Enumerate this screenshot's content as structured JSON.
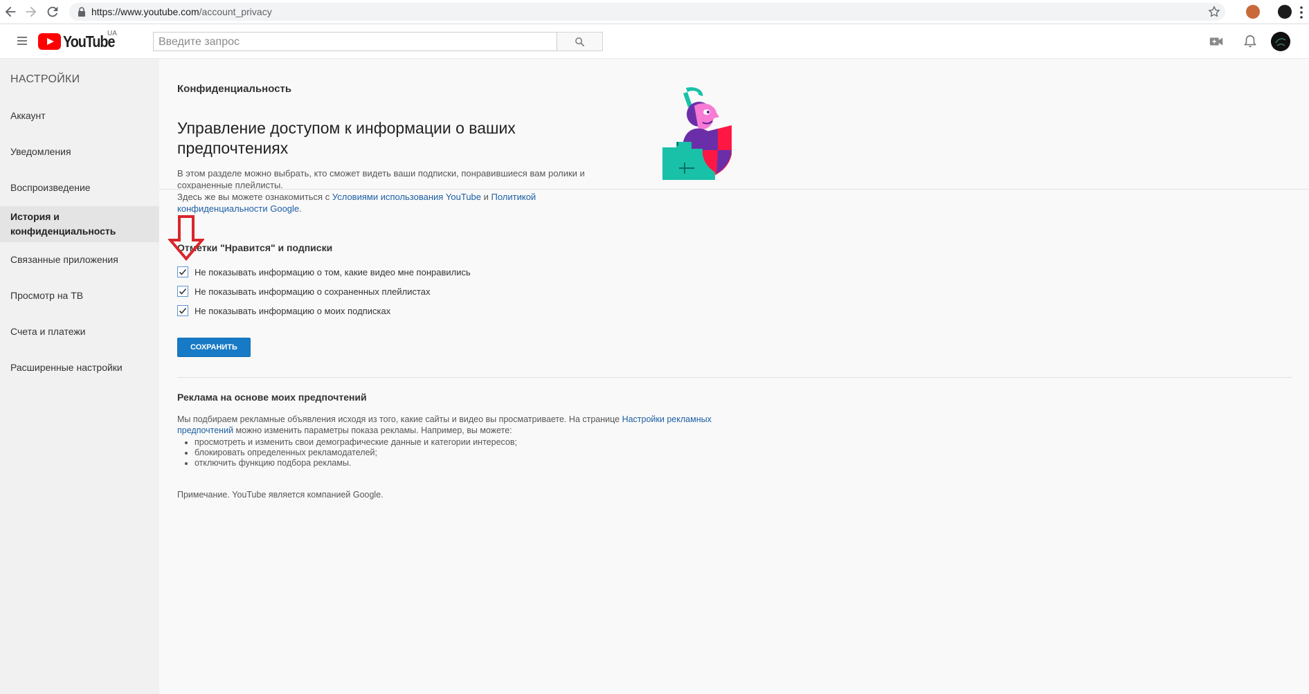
{
  "browser": {
    "url_host": "https://www.youtube.com",
    "url_path": "/account_privacy"
  },
  "header": {
    "logo_text": "YouTube",
    "logo_country": "UA",
    "search_placeholder": "Введите запрос"
  },
  "sidebar": {
    "title": "НАСТРОЙКИ",
    "items": [
      {
        "label": "Аккаунт"
      },
      {
        "label": "Уведомления"
      },
      {
        "label": "Воспроизведение"
      },
      {
        "label": "История и конфиденциальность",
        "active": true
      },
      {
        "label": "Связанные приложения"
      },
      {
        "label": "Просмотр на ТВ"
      },
      {
        "label": "Счета и платежи"
      },
      {
        "label": "Расширенные настройки"
      }
    ]
  },
  "main": {
    "page_title": "Конфиденциальность",
    "headline": "Управление доступом к информации о ваших предпочтениях",
    "desc_line1": "В этом разделе можно выбрать, кто сможет видеть ваши подписки, понравившиеся вам ролики и сохраненные плейлисты.",
    "desc_line2_prefix": "Здесь же вы можете ознакомиться с ",
    "desc_link1": "Условиями использования YouTube",
    "desc_and": " и ",
    "desc_link2": "Политикой конфиденциальности Google",
    "desc_end": ".",
    "likes_section_title": "Отметки \"Нравится\" и подписки",
    "checkboxes": [
      {
        "label": "Не показывать информацию о том, какие видео мне понравились",
        "checked": true
      },
      {
        "label": "Не показывать информацию о сохраненных плейлистах",
        "checked": true
      },
      {
        "label": "Не показывать информацию о моих подписках",
        "checked": true
      }
    ],
    "save_label": "СОХРАНИТЬ",
    "ads_section_title": "Реклама на основе моих предпочтений",
    "ads_desc_prefix": "Мы подбираем рекламные объявления исходя из того, какие сайты и видео вы просматриваете. На странице ",
    "ads_link": "Настройки рекламных предпочтений",
    "ads_desc_suffix": " можно изменить параметры показа рекламы. Например, вы можете:",
    "ads_bullets": [
      "просмотреть и изменить свои демографические данные и категории интересов;",
      "блокировать определенных рекламодателей;",
      "отключить функцию подбора рекламы."
    ],
    "note": "Примечание. YouTube является компанией Google."
  },
  "colors": {
    "accent_blue": "#167ac6",
    "link_blue": "#1c5ea5",
    "annotation_red": "#d9262c",
    "youtube_red": "#ff0000"
  }
}
